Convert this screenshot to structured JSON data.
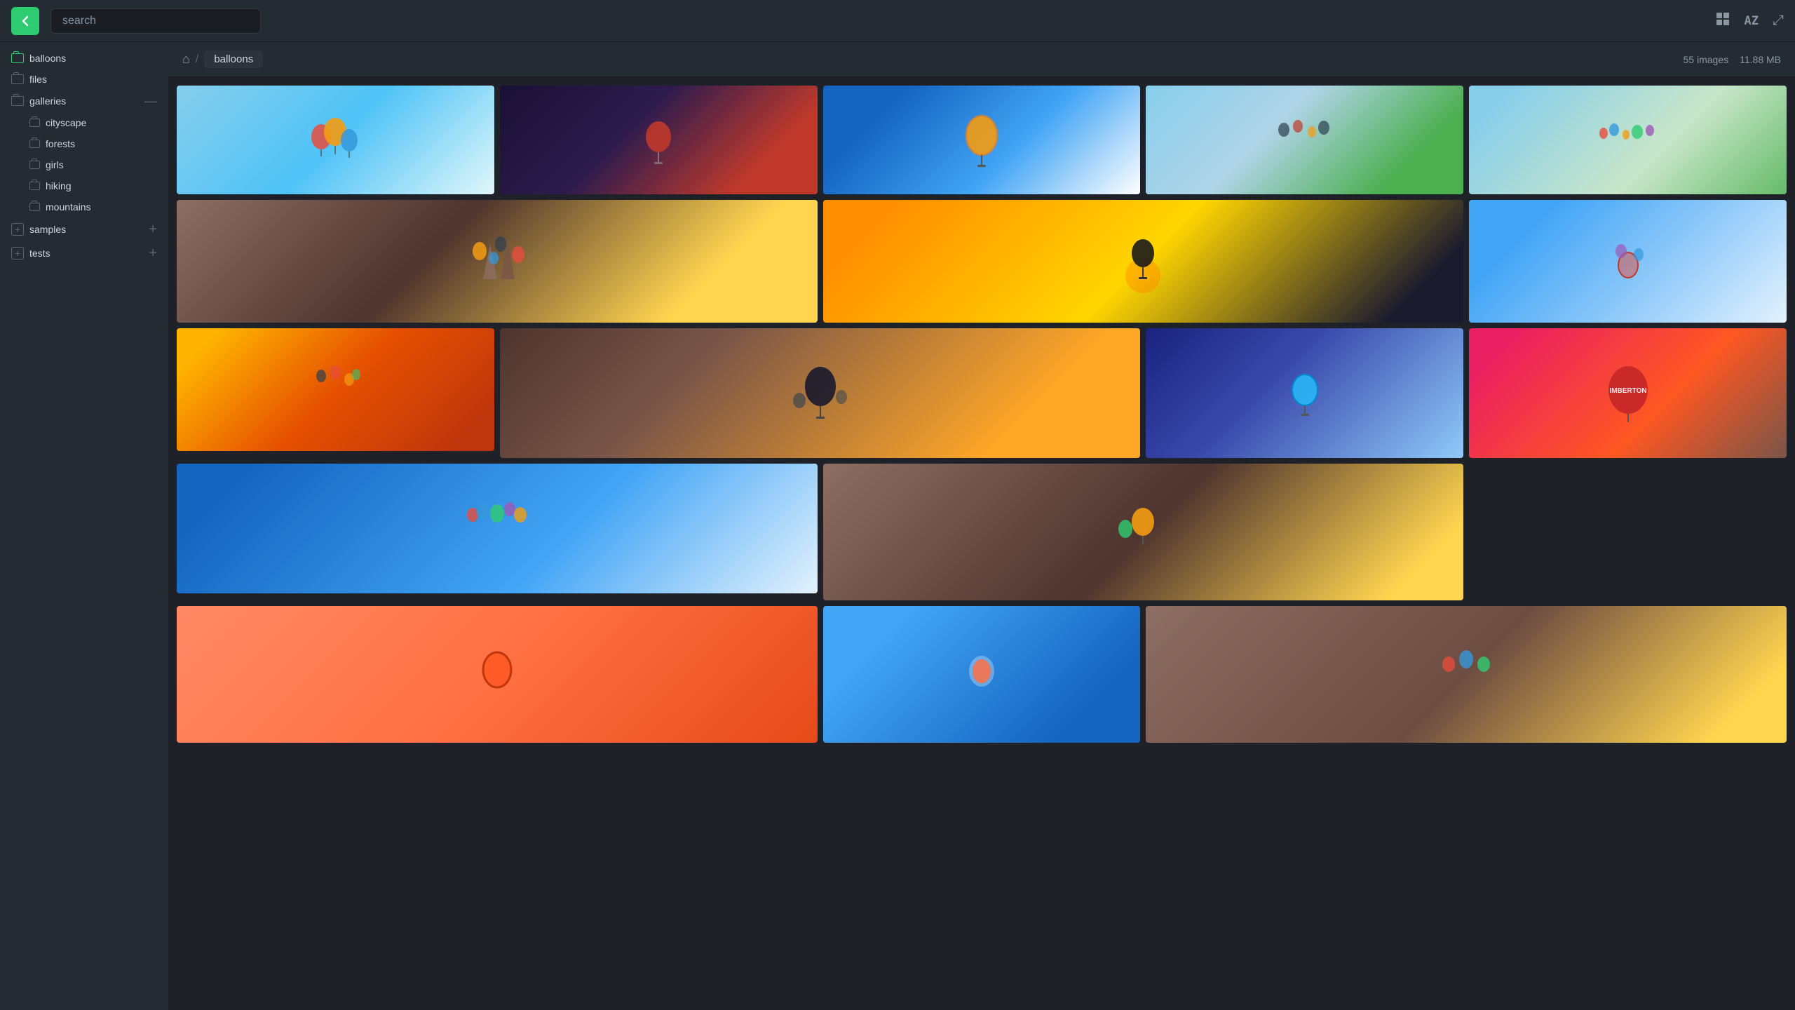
{
  "topbar": {
    "back_icon": "←",
    "search_placeholder": "search",
    "grid_icon": "⊞",
    "sort_icon": "AZ",
    "expand_icon": "⤢"
  },
  "sidebar": {
    "items": [
      {
        "id": "balloons",
        "label": "balloons",
        "indent": 0,
        "type": "folder-active"
      },
      {
        "id": "files",
        "label": "files",
        "indent": 0,
        "type": "folder"
      },
      {
        "id": "galleries",
        "label": "galleries",
        "indent": 0,
        "type": "folder-expand",
        "action": "collapse"
      },
      {
        "id": "cityscape",
        "label": "cityscape",
        "indent": 1,
        "type": "folder-sub"
      },
      {
        "id": "forests",
        "label": "forests",
        "indent": 1,
        "type": "folder-sub"
      },
      {
        "id": "girls",
        "label": "girls",
        "indent": 1,
        "type": "folder-sub"
      },
      {
        "id": "hiking",
        "label": "hiking",
        "indent": 1,
        "type": "folder-sub"
      },
      {
        "id": "mountains",
        "label": "mountains",
        "indent": 1,
        "type": "folder-sub"
      },
      {
        "id": "samples",
        "label": "samples",
        "indent": 0,
        "type": "folder-plus"
      },
      {
        "id": "tests",
        "label": "tests",
        "indent": 0,
        "type": "folder-plus"
      }
    ]
  },
  "breadcrumb": {
    "home_icon": "⌂",
    "separator": "/",
    "current": "balloons",
    "image_count": "55 images",
    "file_size": "11.88 MB"
  },
  "grid": {
    "images": [
      {
        "id": 1,
        "class": "img-balloon-1",
        "row": 1,
        "span": 1
      },
      {
        "id": 2,
        "class": "img-balloon-2",
        "row": 1,
        "span": 1
      },
      {
        "id": 3,
        "class": "img-balloon-3",
        "row": 1,
        "span": 1
      },
      {
        "id": 4,
        "class": "img-balloon-4",
        "row": 1,
        "span": 1
      },
      {
        "id": 5,
        "class": "img-balloon-5",
        "row": 1,
        "span": 1
      },
      {
        "id": 6,
        "class": "img-balloon-6",
        "row": 2,
        "span": 2
      },
      {
        "id": 7,
        "class": "img-balloon-7",
        "row": 2,
        "span": 2
      },
      {
        "id": 8,
        "class": "img-balloon-8",
        "row": 2,
        "span": 1
      },
      {
        "id": 9,
        "class": "img-balloon-9",
        "row": 2,
        "span": 1
      },
      {
        "id": 10,
        "class": "img-balloon-10",
        "row": 3,
        "span": 2
      },
      {
        "id": 11,
        "class": "img-balloon-11",
        "row": 3,
        "span": 2
      },
      {
        "id": 12,
        "class": "img-balloon-12",
        "row": 3,
        "span": 1
      },
      {
        "id": 13,
        "class": "img-balloon-13",
        "row": 3,
        "span": 1
      },
      {
        "id": 14,
        "class": "img-balloon-14",
        "row": 4,
        "span": 2
      }
    ]
  }
}
